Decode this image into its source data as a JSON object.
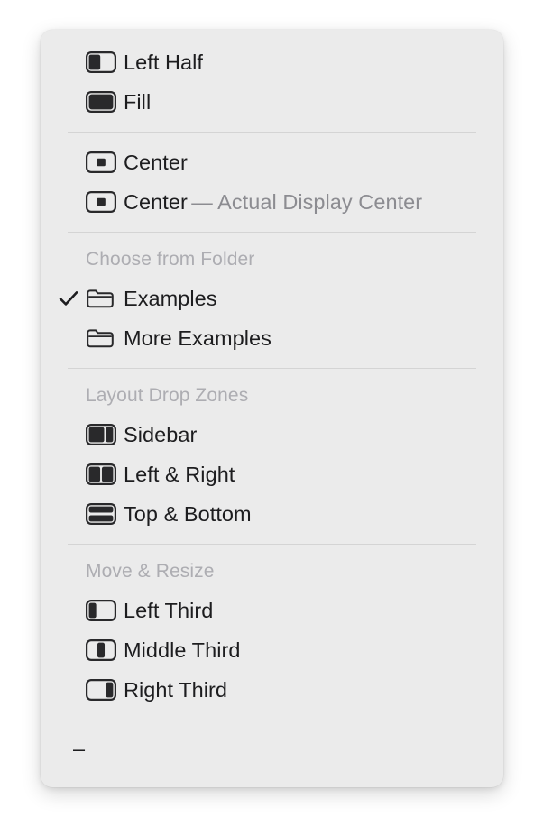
{
  "menu": {
    "background_color": "#ebebeb",
    "label_color": "#1d1d1f",
    "dim_color": "#8c8c91",
    "header_color": "#adadb2",
    "separator_color": "#d4d4d4",
    "sections": [
      {
        "header": null,
        "items": [
          {
            "label": "Left Half",
            "secondary": null,
            "icon": "window-left-half-icon",
            "checked": false
          },
          {
            "label": "Fill",
            "secondary": null,
            "icon": "window-fill-icon",
            "checked": false
          }
        ]
      },
      {
        "header": null,
        "items": [
          {
            "label": "Center",
            "secondary": null,
            "icon": "window-center-icon",
            "checked": false
          },
          {
            "label": "Center",
            "secondary": "— Actual Display Center",
            "icon": "window-center-icon",
            "checked": false
          }
        ]
      },
      {
        "header": "Choose from Folder",
        "items": [
          {
            "label": "Examples",
            "secondary": null,
            "icon": "folder-icon",
            "checked": true
          },
          {
            "label": "More Examples",
            "secondary": null,
            "icon": "folder-icon",
            "checked": false
          }
        ]
      },
      {
        "header": "Layout Drop Zones",
        "items": [
          {
            "label": "Sidebar",
            "secondary": null,
            "icon": "window-sidebar-icon",
            "checked": false
          },
          {
            "label": "Left & Right",
            "secondary": null,
            "icon": "window-left-right-icon",
            "checked": false
          },
          {
            "label": "Top & Bottom",
            "secondary": null,
            "icon": "window-top-bottom-icon",
            "checked": false
          }
        ]
      },
      {
        "header": "Move & Resize",
        "items": [
          {
            "label": "Left Third",
            "secondary": null,
            "icon": "window-left-third-icon",
            "checked": false
          },
          {
            "label": "Middle Third",
            "secondary": null,
            "icon": "window-middle-third-icon",
            "checked": false
          },
          {
            "label": "Right Third",
            "secondary": null,
            "icon": "window-right-third-icon",
            "checked": false
          }
        ]
      },
      {
        "header": null,
        "items": [
          {
            "label": "–",
            "secondary": null,
            "icon": null,
            "checked": false,
            "is_dash": true
          }
        ]
      }
    ]
  }
}
